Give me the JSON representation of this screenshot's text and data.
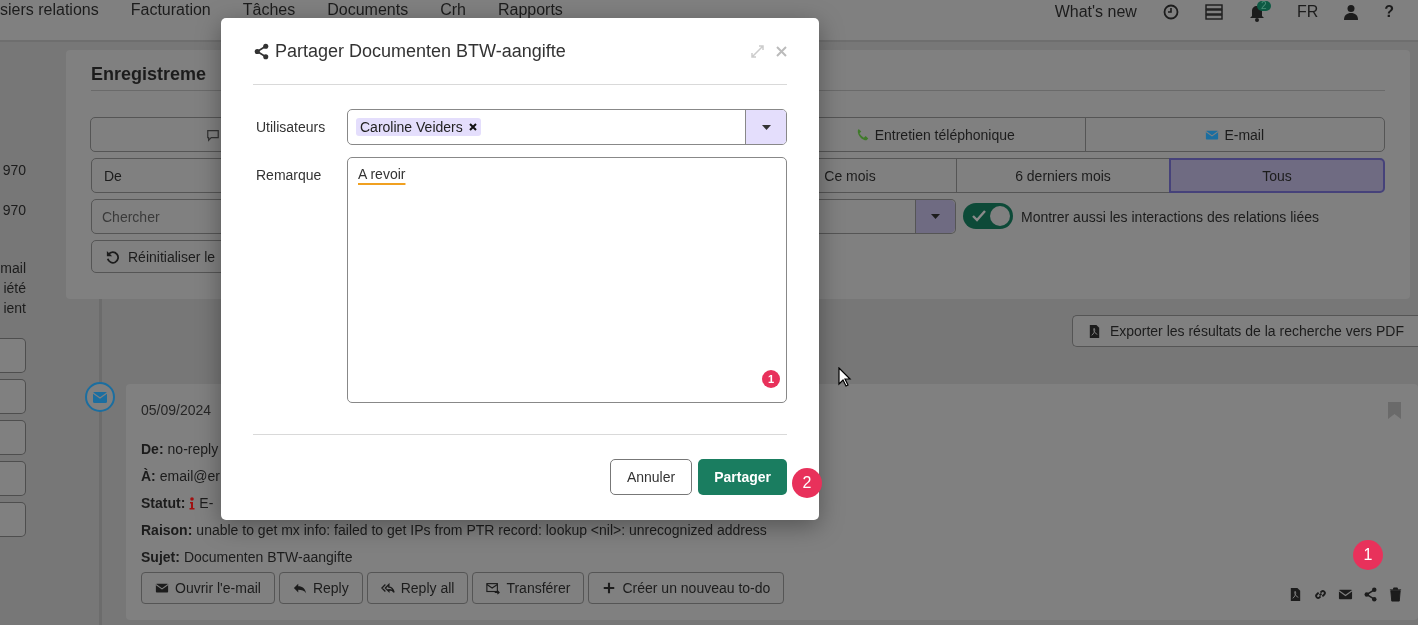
{
  "nav": {
    "items": [
      "siers relations",
      "Facturation",
      "Tâches",
      "Documents",
      "Crh",
      "Rapports"
    ],
    "whats_new": "What's new",
    "notification_count": "2",
    "language": "FR",
    "help": "?"
  },
  "left_column": {
    "texts": [
      "970",
      "970",
      "mail",
      "iété",
      "ient"
    ]
  },
  "panel": {
    "title": "Enregistreme",
    "type_filters": [
      {
        "kind": "chat"
      },
      {
        "kind": "phone",
        "label": "Entretien téléphonique"
      },
      {
        "kind": "email",
        "label": "E-mail"
      }
    ],
    "from_label": "De",
    "ranges": [
      {
        "label": "Ce mois",
        "selected": false
      },
      {
        "label": "6 derniers mois",
        "selected": false
      },
      {
        "label": "Tous",
        "selected": true
      }
    ],
    "search": {
      "placeholder": "Chercher"
    },
    "linked": {
      "on": true,
      "label": "Montrer aussi les interactions des relations liées"
    },
    "reset": "Réinitialiser le"
  },
  "export": "Exporter les résultats de la recherche vers PDF",
  "entry": {
    "date": "05/09/2024",
    "fields": [
      {
        "kind": "plain",
        "label": "De:",
        "value": "no-reply"
      },
      {
        "kind": "plain",
        "label": "À:",
        "value": "email@er"
      },
      {
        "kind": "status",
        "label": "Statut:",
        "value": "E-"
      },
      {
        "kind": "plain",
        "label": "Raison:",
        "value": "unable to get mx info: failed to get IPs from PTR record: lookup <nil>: unrecognized address"
      },
      {
        "kind": "plain",
        "label": "Sujet:",
        "value": "Documenten BTW-aangifte"
      }
    ],
    "actions": [
      {
        "kind": "open",
        "label": "Ouvrir l'e-mail"
      },
      {
        "kind": "reply",
        "label": "Reply"
      },
      {
        "kind": "reply_all",
        "label": "Reply all"
      },
      {
        "kind": "forward",
        "label": "Transférer"
      },
      {
        "kind": "todo",
        "label": "Créer un nouveau to-do"
      }
    ],
    "icon_actions": [
      {
        "kind": "pdf"
      },
      {
        "kind": "link"
      },
      {
        "kind": "email"
      },
      {
        "kind": "share"
      },
      {
        "kind": "delete"
      }
    ],
    "share_badge": "1"
  },
  "modal": {
    "title": "Partager Documenten BTW-aangifte",
    "users_label": "Utilisateurs",
    "users": [
      "Caroline Veiders"
    ],
    "remark_label": "Remarque",
    "remark": "A revoir",
    "remark_badge": "1",
    "cancel": "Annuler",
    "submit": "Partager",
    "submit_badge": "2"
  }
}
